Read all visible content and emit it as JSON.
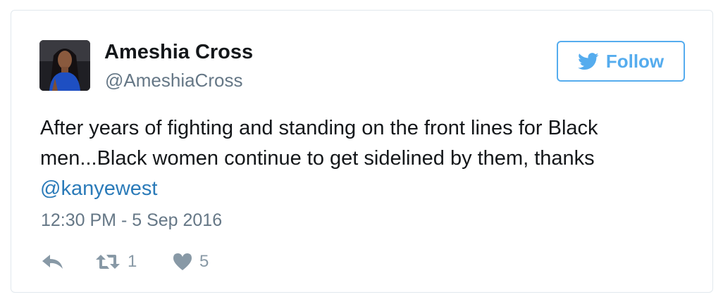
{
  "author": {
    "display_name": "Ameshia Cross",
    "handle": "@AmeshiaCross",
    "avatar_icon": "profile-photo"
  },
  "follow_button": {
    "label": "Follow",
    "icon": "twitter-bird-icon",
    "color": "#55acee"
  },
  "tweet": {
    "text_before_mention": "After years of fighting and standing on the front lines for Black men...Black women continue to get sidelined by them, thanks ",
    "mention": "@kanyewest",
    "timestamp": "12:30 PM - 5 Sep 2016"
  },
  "actions": {
    "reply_icon": "reply-icon",
    "retweet_icon": "retweet-icon",
    "retweet_count": "1",
    "like_icon": "heart-icon",
    "like_count": "5"
  },
  "colors": {
    "text": "#14171a",
    "secondary": "#657786",
    "link": "#2b7bb9",
    "action_gray": "#8899a6",
    "border": "#e1e8ed"
  }
}
